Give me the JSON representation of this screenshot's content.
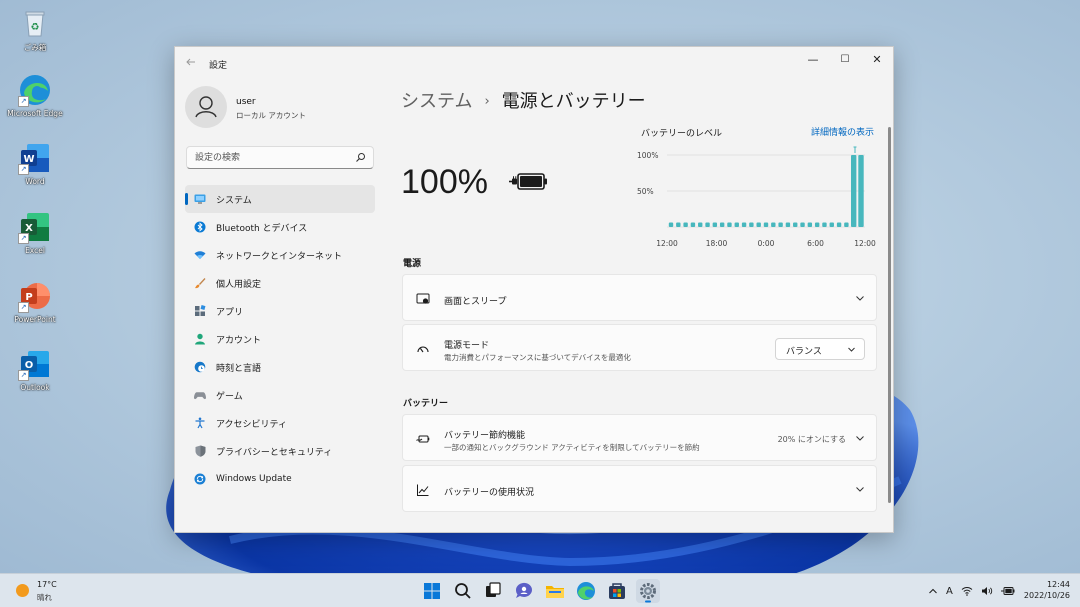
{
  "desktop": {
    "icons": [
      {
        "label": "ごみ箱",
        "name": "recycle-bin"
      },
      {
        "label": "Microsoft Edge",
        "name": "edge"
      },
      {
        "label": "Word",
        "name": "word"
      },
      {
        "label": "Excel",
        "name": "excel"
      },
      {
        "label": "PowerPoint",
        "name": "powerpoint"
      },
      {
        "label": "Outlook",
        "name": "outlook"
      }
    ]
  },
  "window": {
    "title": "設定",
    "controls": {
      "minimize": "—",
      "maximize": "☐",
      "close": "✕"
    }
  },
  "user": {
    "name": "user",
    "account_type": "ローカル アカウント"
  },
  "search": {
    "placeholder": "設定の検索"
  },
  "nav": [
    {
      "label": "システム",
      "icon": "monitor-icon",
      "active": true
    },
    {
      "label": "Bluetooth とデバイス",
      "icon": "bluetooth-icon"
    },
    {
      "label": "ネットワークとインターネット",
      "icon": "wifi-icon"
    },
    {
      "label": "個人用設定",
      "icon": "brush-icon"
    },
    {
      "label": "アプリ",
      "icon": "apps-icon"
    },
    {
      "label": "アカウント",
      "icon": "person-icon"
    },
    {
      "label": "時刻と言語",
      "icon": "globe-clock-icon"
    },
    {
      "label": "ゲーム",
      "icon": "gamepad-icon"
    },
    {
      "label": "アクセシビリティ",
      "icon": "accessibility-icon"
    },
    {
      "label": "プライバシーとセキュリティ",
      "icon": "shield-icon"
    },
    {
      "label": "Windows Update",
      "icon": "update-icon"
    }
  ],
  "breadcrumb": {
    "parent": "システム",
    "separator": "›",
    "current": "電源とバッテリー"
  },
  "battery": {
    "percent_text": "100%",
    "percent": 100,
    "charging": true
  },
  "battery_level": {
    "title": "バッテリーのレベル",
    "details_link": "詳細情報の表示"
  },
  "chart_data": {
    "type": "bar",
    "y_ticks": [
      "100%",
      "50%"
    ],
    "x_ticks": [
      "12:00",
      "18:00",
      "0:00",
      "6:00",
      "12:00"
    ],
    "values": [
      0,
      0,
      0,
      0,
      0,
      0,
      0,
      0,
      0,
      0,
      0,
      0,
      0,
      0,
      0,
      0,
      0,
      0,
      0,
      0,
      0,
      0,
      0,
      0,
      0,
      100,
      100
    ],
    "ylim": [
      0,
      100
    ],
    "bar_color": "#47b7bd"
  },
  "sections": {
    "power": "電源",
    "battery": "バッテリー"
  },
  "cards": {
    "screen_sleep": {
      "title": "画面とスリープ"
    },
    "power_mode": {
      "title": "電源モード",
      "subtitle": "電力消費とパフォーマンスに基づいてデバイスを最適化",
      "value": "バランス"
    },
    "battery_saver": {
      "title": "バッテリー節約機能",
      "subtitle": "一部の通知とバックグラウンド アクティビティを制限してバッテリーを節約",
      "value": "20% にオンにする"
    },
    "battery_usage": {
      "title": "バッテリーの使用状況"
    }
  },
  "taskbar": {
    "weather": {
      "temp": "17°C",
      "condition": "晴れ"
    },
    "clock": {
      "time": "12:44",
      "date": "2022/10/26"
    },
    "ime": "A"
  },
  "colors": {
    "accent": "#0067c0",
    "chart": "#47b7bd"
  }
}
